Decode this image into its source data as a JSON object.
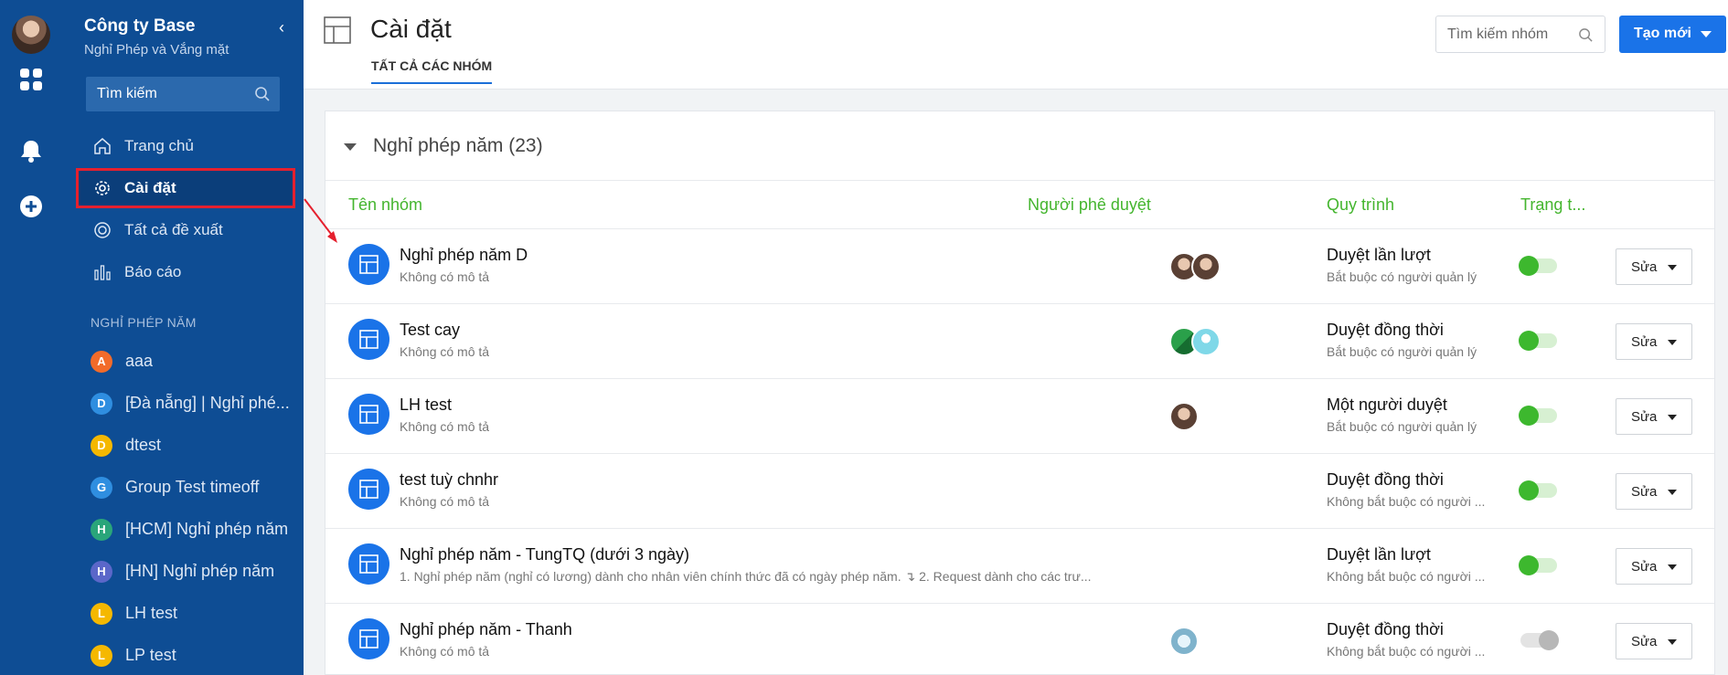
{
  "sidebar": {
    "company": "Công ty Base",
    "module": "Nghỉ Phép và Vắng mặt",
    "search_placeholder": "Tìm kiếm",
    "nav": [
      {
        "label": "Trang chủ",
        "icon": "home-icon"
      },
      {
        "label": "Cài đặt",
        "icon": "gear-icon",
        "active": true
      },
      {
        "label": "Tất cả đề xuất",
        "icon": "circle-icon"
      },
      {
        "label": "Báo cáo",
        "icon": "bar-chart-icon"
      }
    ],
    "section_title": "NGHỈ PHÉP NĂM",
    "groups": [
      {
        "letter": "A",
        "label": "aaa",
        "color": "#f26b2a"
      },
      {
        "letter": "D",
        "label": "[Đà nẵng] | Nghỉ phé...",
        "color": "#2f8ee0"
      },
      {
        "letter": "D",
        "label": "dtest",
        "color": "#f5b800"
      },
      {
        "letter": "G",
        "label": "Group Test timeoff",
        "color": "#2f8ee0"
      },
      {
        "letter": "H",
        "label": "[HCM] Nghỉ phép năm",
        "color": "#2aa57a"
      },
      {
        "letter": "H",
        "label": "[HN] Nghỉ phép năm",
        "color": "#5b67c9"
      },
      {
        "letter": "L",
        "label": "LH test",
        "color": "#f5b800"
      },
      {
        "letter": "L",
        "label": "LP test",
        "color": "#f5b800"
      }
    ]
  },
  "header": {
    "title": "Cài đặt",
    "tab": "TẤT CẢ CÁC NHÓM",
    "search_placeholder": "Tìm kiếm nhóm",
    "create_label": "Tạo mới"
  },
  "card": {
    "title": "Nghỉ phép năm (23)",
    "columns": {
      "name": "Tên nhóm",
      "approver": "Người phê duyệt",
      "process": "Quy trình",
      "status": "Trạng t..."
    },
    "edit_label": "Sửa",
    "rows": [
      {
        "name": "Nghỉ phép năm D",
        "desc": "Không có mô tả",
        "process": "Duyệt lần lượt",
        "process_sub": "Bắt buộc có người quản lý",
        "enabled": true,
        "approvers": [
          "photo",
          "photo"
        ]
      },
      {
        "name": "Test cay",
        "desc": "Không có mô tả",
        "process": "Duyệt đồng thời",
        "process_sub": "Bắt buộc có người quản lý",
        "enabled": true,
        "approvers": [
          "logo",
          "default"
        ]
      },
      {
        "name": "LH test",
        "desc": "Không có mô tả",
        "process": "Một người duyệt",
        "process_sub": "Bắt buộc có người quản lý",
        "enabled": true,
        "approvers": [
          "photo"
        ]
      },
      {
        "name": "test tuỳ chnhr",
        "desc": "Không có mô tả",
        "process": "Duyệt đồng thời",
        "process_sub": "Không bắt buộc có người ...",
        "enabled": true,
        "approvers": []
      },
      {
        "name": "Nghỉ phép năm - TungTQ (dưới 3 ngày)",
        "desc": "1. Nghỉ phép năm (nghỉ có lương) dành cho nhân viên chính thức đã có ngày phép năm. ↴ 2. Request dành cho các trư...",
        "process": "Duyệt lần lượt",
        "process_sub": "Không bắt buộc có người ...",
        "enabled": true,
        "approvers": []
      },
      {
        "name": "Nghỉ phép năm - Thanh",
        "desc": "Không có mô tả",
        "process": "Duyệt đồng thời",
        "process_sub": "Không bắt buộc có người ...",
        "enabled": false,
        "approvers": [
          "globe"
        ]
      }
    ]
  },
  "colors": {
    "sidebar_bg": "#0e4d94",
    "accent": "#1a73e8",
    "column_header": "#44b52e",
    "highlight": "#e5202e"
  }
}
